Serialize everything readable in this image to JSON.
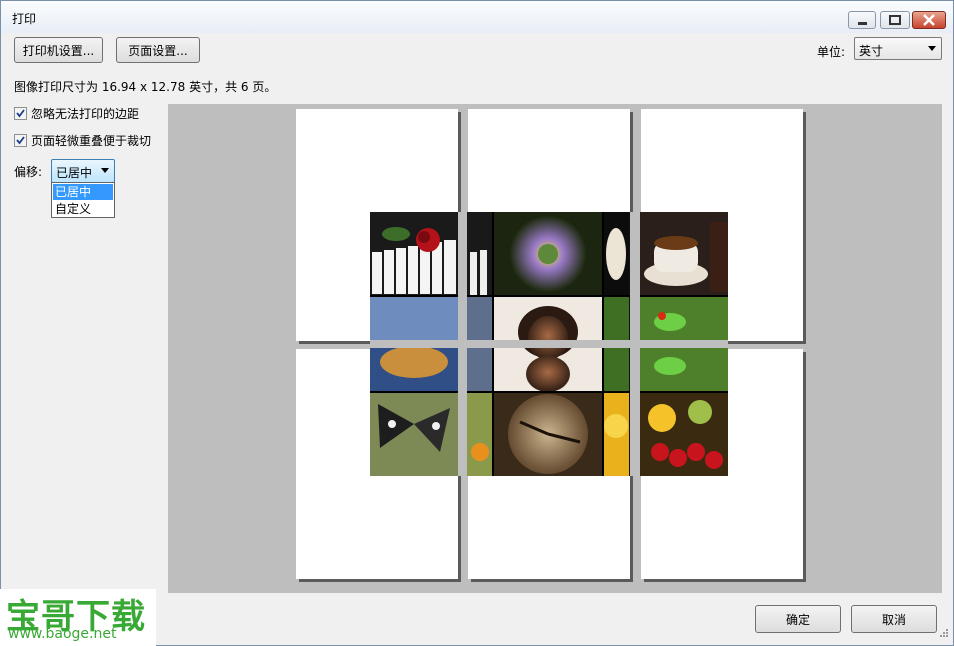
{
  "window": {
    "title": "打印"
  },
  "toolbar": {
    "printer_settings": "打印机设置...",
    "page_settings": "页面设置...",
    "unit_label": "单位:",
    "unit_value": "英寸"
  },
  "info": {
    "size_text": "图像打印尺寸为 16.94 x 12.78 英寸，共 6 页。"
  },
  "options": {
    "ignore_margins": {
      "label": "忽略无法打印的边距",
      "checked": true
    },
    "overlap_pages": {
      "label": "页面轻微重叠便于裁切",
      "checked": true
    },
    "offset_label": "偏移:",
    "offset_value": "已居中",
    "offset_options": [
      "已居中",
      "自定义"
    ]
  },
  "footer": {
    "ok": "确定",
    "cancel": "取消"
  },
  "watermark": {
    "brand": "宝哥下载",
    "url": "www.baoge.net"
  },
  "preview": {
    "pages": 6,
    "photos": [
      "piano-rose",
      "passion-flower",
      "coffee-cup",
      "hot-air-balloon",
      "smiling-woman",
      "tree-frog",
      "butterfly",
      "clock",
      "fruit"
    ]
  }
}
